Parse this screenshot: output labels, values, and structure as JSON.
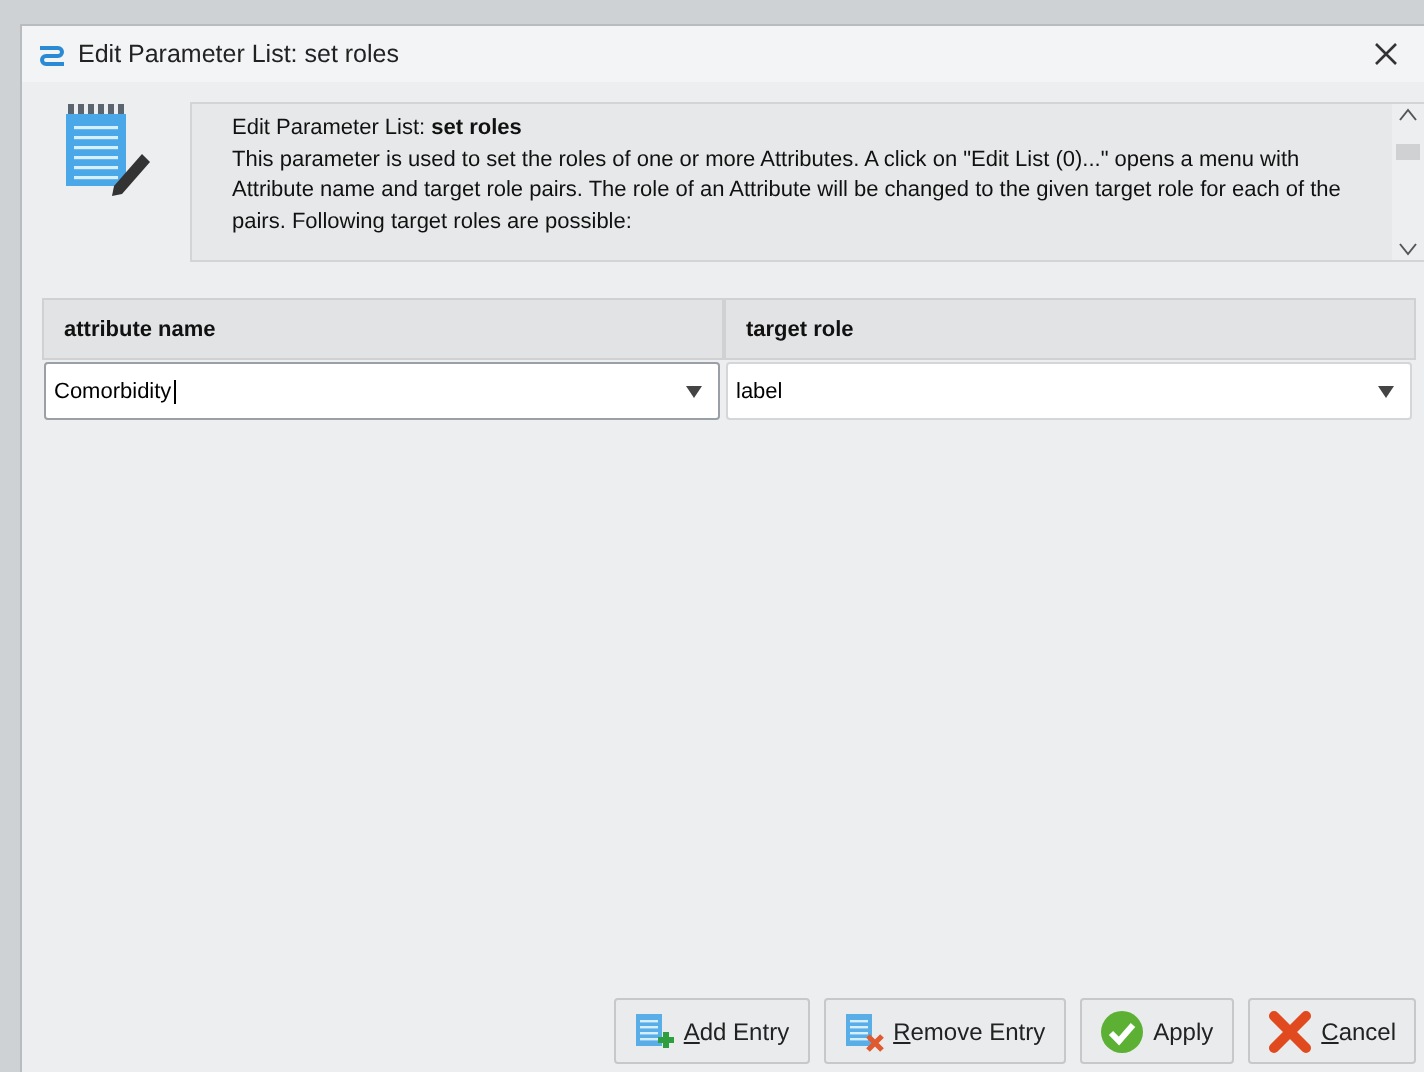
{
  "window": {
    "title": "Edit Parameter List: set roles"
  },
  "description": {
    "heading": "Edit Parameter List: **set roles**",
    "text": "This parameter is used to set the roles of one or more Attributes. A click on \"Edit List (0)...\" opens a menu with Attribute name and target role pairs. The role of an Attribute will be changed to the given target role for each of the pairs. Following target roles are possible:"
  },
  "table": {
    "columns": [
      "attribute name",
      "target role"
    ],
    "rows": [
      {
        "cells": [
          {
            "value": "Comorbidity",
            "focused": true
          },
          {
            "value": "label",
            "focused": false
          }
        ]
      }
    ]
  },
  "buttons": [
    {
      "label": "Add Entry",
      "kind": "add",
      "mnemonic": true
    },
    {
      "label": "Remove Entry",
      "kind": "remove",
      "mnemonic": true
    },
    {
      "label": "Apply",
      "kind": "apply",
      "mnemonic": false
    },
    {
      "label": "Cancel",
      "kind": "cancel",
      "mnemonic": true
    }
  ]
}
